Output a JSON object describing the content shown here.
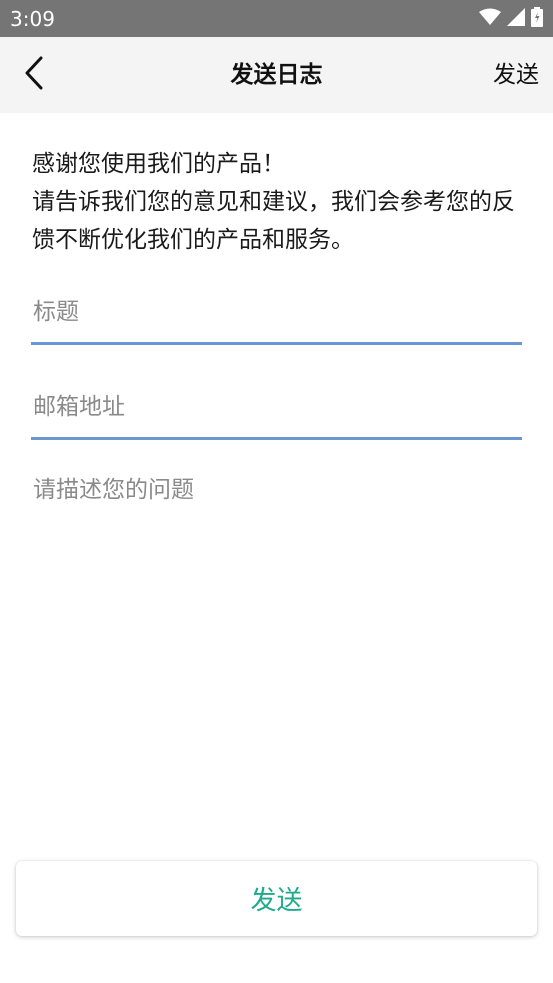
{
  "status_bar": {
    "time": "3:09",
    "icons": [
      "wifi-icon",
      "signal-icon",
      "battery-icon"
    ]
  },
  "header": {
    "back_icon": "back-chevron-icon",
    "title": "发送日志",
    "action_label": "发送"
  },
  "intro": {
    "line1": "感谢您使用我们的产品！",
    "line2": "请告诉我们您的意见和建议，我们会参考您的反馈不断优化我们的产品和服务。"
  },
  "form": {
    "title_placeholder": "标题",
    "email_placeholder": "邮箱地址",
    "description_placeholder": "请描述您的问题",
    "underline_color": "#6a96d2"
  },
  "footer": {
    "send_label": "发送",
    "send_color": "#1faa8c"
  }
}
